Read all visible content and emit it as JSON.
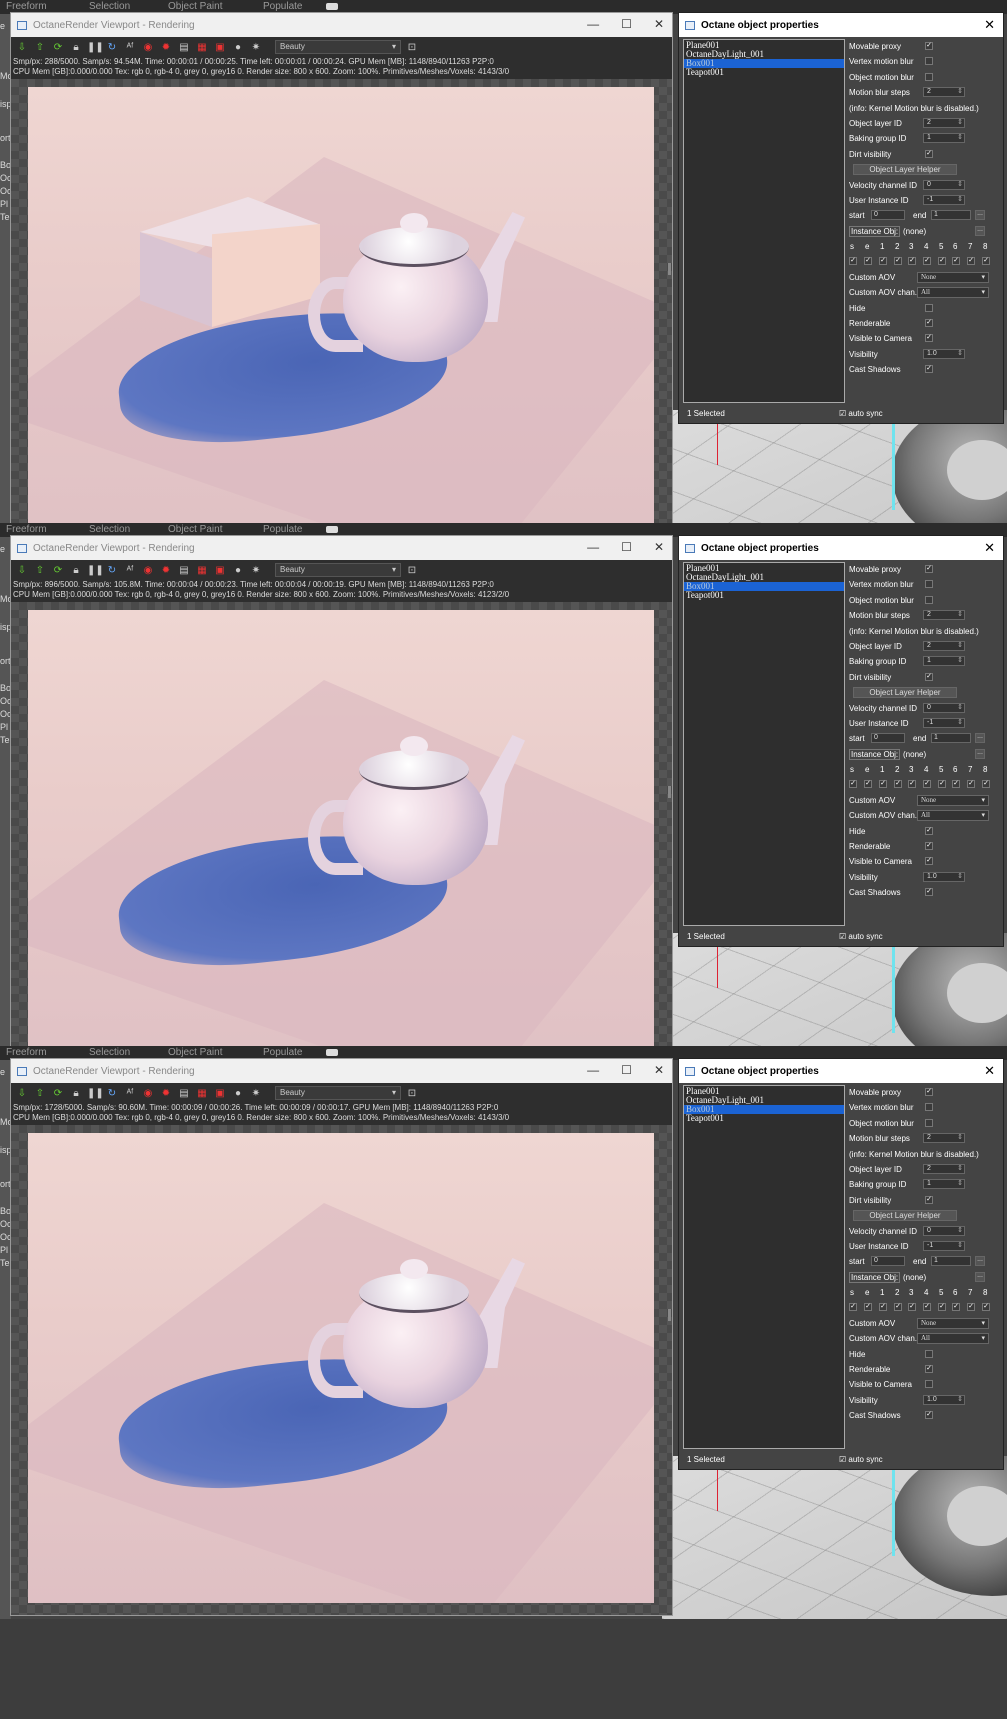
{
  "menu": [
    "Freeform",
    "Selection",
    "Object Paint",
    "Populate"
  ],
  "left_panel": [
    "e",
    "Mo",
    "isp",
    "ort",
    "Bo",
    "Oc",
    "Oc",
    "Pl",
    "Te"
  ],
  "viewport": {
    "title": "OctaneRender Viewport - Rendering",
    "pass_select": "Beauty",
    "toolbar_icons": [
      "import-icon",
      "export-icon",
      "refresh-icon",
      "lock-icon",
      "pause-icon",
      "restart-icon",
      "af-icon",
      "color-icon",
      "clay-icon",
      "region-icon",
      "film-icon",
      "record-icon",
      "sphere-icon",
      "settings-icon"
    ]
  },
  "props": {
    "title": "Octane object properties",
    "objects": [
      "Plane001",
      "OctaneDayLight_001",
      "Box001",
      "Teapot001"
    ],
    "selected_count": "1 Selected",
    "auto_sync": "auto sync",
    "labels": {
      "movable_proxy": "Movable proxy",
      "vertex_motion_blur": "Vertex motion blur",
      "object_motion_blur": "Object motion blur",
      "motion_blur_steps": "Motion blur steps",
      "info": "(info: Kernel Motion blur is disabled.)",
      "object_layer_id": "Object layer ID",
      "baking_group_id": "Baking group ID",
      "dirt_visibility": "Dirt visibility",
      "object_layer_helper": "Object Layer Helper",
      "velocity_channel_id": "Velocity channel ID",
      "user_instance_id": "User Instance ID",
      "start": "start",
      "end": "end",
      "instance_obj": "Instance Obj:",
      "none": "(none)",
      "custom_aov": "Custom AOV",
      "custom_aov_chan": "Custom AOV chan.",
      "hide": "Hide",
      "renderable": "Renderable",
      "visible_to_camera": "Visible to Camera",
      "visibility": "Visibility",
      "cast_shadows": "Cast Shadows"
    },
    "values": {
      "motion_blur_steps": "2",
      "object_layer_id": "2",
      "baking_group_id": "1",
      "velocity_channel_id": "0",
      "user_instance_id": "-1",
      "start": "0",
      "end": "1",
      "custom_aov": "None",
      "custom_aov_chan": "All",
      "visibility": "1.0",
      "dots": "..."
    },
    "layer_header": [
      "s",
      "e",
      "1",
      "2",
      "3",
      "4",
      "5",
      "6",
      "7",
      "8"
    ]
  },
  "frames": [
    {
      "stats1": "Smp/px: 288/5000.   Samp/s: 94.54M.   Time: 00:00:01 / 00:00:25.   Time left: 00:00:01 / 00:00:24.   GPU Mem [MB]: 1148/8940/11263 P2P:0",
      "stats2": "CPU Mem [GB]:0.000/0.000   Tex: rgb 0, rgb-4 0, grey 0, grey16 0.   Render size: 800 x 600.   Zoom: 100%.   Primitives/Meshes/Voxels: 4143/3/0",
      "show_box": true,
      "checks": {
        "movable_proxy": true,
        "vertex_motion_blur": false,
        "object_motion_blur": false,
        "dirt_visibility": true,
        "hide": false,
        "renderable": true,
        "visible_to_camera": true,
        "cast_shadows": true
      }
    },
    {
      "stats1": "Smp/px: 896/5000.   Samp/s: 105.8M.   Time: 00:00:04 / 00:00:23.   Time left: 00:00:04 / 00:00:19.   GPU Mem [MB]: 1148/8940/11263 P2P:0",
      "stats2": "CPU Mem [GB]:0.000/0.000   Tex: rgb 0, rgb-4 0, grey 0, grey16 0.   Render size: 800 x 600.   Zoom: 100%.   Primitives/Meshes/Voxels: 4123/2/0",
      "show_box": false,
      "checks": {
        "movable_proxy": true,
        "vertex_motion_blur": false,
        "object_motion_blur": false,
        "dirt_visibility": true,
        "hide": true,
        "renderable": true,
        "visible_to_camera": true,
        "cast_shadows": true
      }
    },
    {
      "stats1": "Smp/px: 1728/5000.   Samp/s: 90.60M.   Time: 00:00:09 / 00:00:26.   Time left: 00:00:09 / 00:00:17.   GPU Mem [MB]: 1148/8940/11263 P2P:0",
      "stats2": "CPU Mem [GB]:0.000/0.000   Tex: rgb 0, rgb-4 0, grey 0, grey16 0.   Render size: 800 x 600.   Zoom: 100%.   Primitives/Meshes/Voxels: 4143/3/0",
      "show_box": false,
      "checks": {
        "movable_proxy": true,
        "vertex_motion_blur": false,
        "object_motion_blur": false,
        "dirt_visibility": true,
        "hide": false,
        "renderable": true,
        "visible_to_camera": false,
        "cast_shadows": true
      }
    }
  ]
}
